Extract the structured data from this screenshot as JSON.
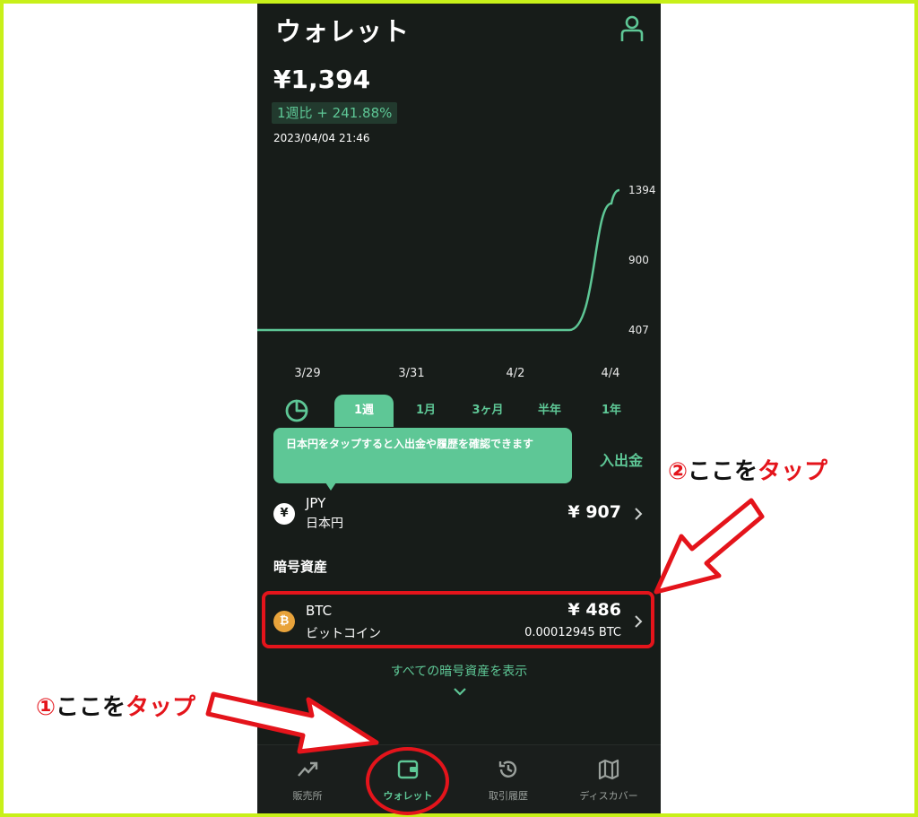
{
  "header": {
    "title": "ウォレット",
    "account_icon": "user-icon"
  },
  "summary": {
    "balance": "¥1,394",
    "weekly_change": "1週比 + 241.88%",
    "timestamp": "2023/04/04 21:46"
  },
  "chart_data": {
    "type": "line",
    "x": [
      "3/29",
      "3/30",
      "3/31",
      "4/1",
      "4/2",
      "4/3",
      "4/3 12:00",
      "4/4",
      "4/4 21:46"
    ],
    "values": [
      407,
      407,
      407,
      407,
      407,
      407,
      407,
      1300,
      1394
    ],
    "x_tick_labels": [
      "3/29",
      "3/31",
      "4/2",
      "4/4"
    ],
    "y_tick_labels": [
      "1394",
      "900",
      "407"
    ],
    "ylim": [
      407,
      1394
    ],
    "line_color": "#5ec796",
    "grid": false
  },
  "period_tabs": [
    {
      "label": "1週",
      "active": true
    },
    {
      "label": "1月",
      "active": false
    },
    {
      "label": "3ヶ月",
      "active": false
    },
    {
      "label": "半年",
      "active": false
    },
    {
      "label": "1年",
      "active": false
    }
  ],
  "tooltip": {
    "text": "日本円をタップすると入出金や履歴を確認できます"
  },
  "deposit_button": "入出金",
  "fiat": {
    "code": "JPY",
    "name": "日本円",
    "value": "¥ 907",
    "icon_glyph": "¥"
  },
  "crypto_section": {
    "title": "暗号資産",
    "items": [
      {
        "code": "BTC",
        "name": "ビットコイン",
        "value": "¥ 486",
        "amount": "0.00012945 BTC",
        "icon_glyph": "₿"
      }
    ],
    "show_all": "すべての暗号資産を表示"
  },
  "bottom_nav": [
    {
      "label": "販売所",
      "icon": "trend-up-icon",
      "active": false
    },
    {
      "label": "ウォレット",
      "icon": "wallet-icon",
      "active": true
    },
    {
      "label": "取引履歴",
      "icon": "history-icon",
      "active": false
    },
    {
      "label": "ディスカバー",
      "icon": "map-icon",
      "active": false
    }
  ],
  "annotations": {
    "step1_num": "①",
    "step1_text": "ここを",
    "step1_action": "タップ",
    "step2_num": "②",
    "step2_text": "ここを",
    "step2_action": "タップ"
  },
  "colors": {
    "accent": "#5ec796",
    "background": "#171c19",
    "annotation_red": "#e4141b",
    "frame": "#c8f019",
    "btc": "#e8a33b"
  }
}
